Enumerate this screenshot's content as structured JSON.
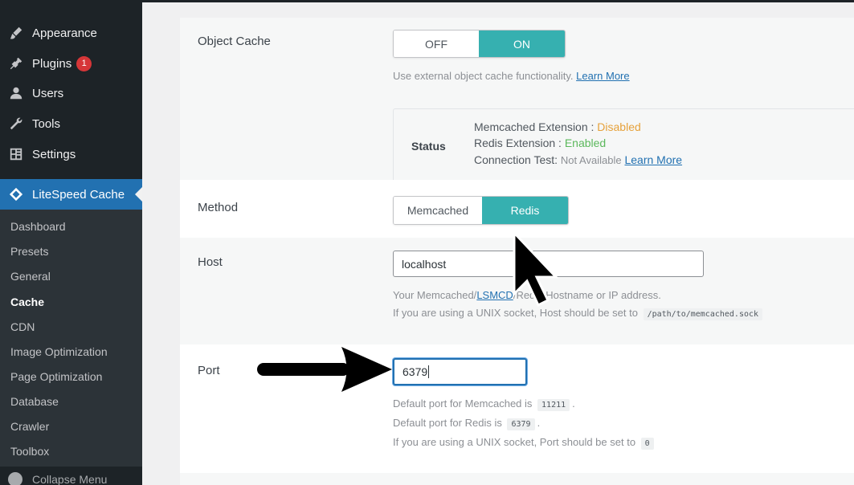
{
  "sidebar": {
    "items": [
      {
        "label": "Appearance",
        "icon": "paintbrush-icon"
      },
      {
        "label": "Plugins",
        "icon": "plugin-icon",
        "badge": "1"
      },
      {
        "label": "Users",
        "icon": "user-icon"
      },
      {
        "label": "Tools",
        "icon": "wrench-icon"
      },
      {
        "label": "Settings",
        "icon": "settings-icon"
      }
    ],
    "active_plugin": {
      "label": "LiteSpeed Cache",
      "icon": "litespeed-diamond-icon"
    },
    "submenu": [
      "Dashboard",
      "Presets",
      "General",
      "Cache",
      "CDN",
      "Image Optimization",
      "Page Optimization",
      "Database",
      "Crawler",
      "Toolbox"
    ],
    "active_submenu": "Cache",
    "collapse_label": "Collapse Menu"
  },
  "object_cache": {
    "label": "Object Cache",
    "off_label": "OFF",
    "on_label": "ON",
    "selected": "ON",
    "desc": "Use external object cache functionality.",
    "learn_more": "Learn More",
    "status": {
      "title": "Status",
      "memcached_label": "Memcached Extension :",
      "memcached_value": "Disabled",
      "redis_label": "Redis Extension :",
      "redis_value": "Enabled",
      "conn_label": "Connection Test:",
      "conn_value": "Not Available",
      "learn_more": "Learn More"
    }
  },
  "method": {
    "label": "Method",
    "memcached_label": "Memcached",
    "redis_label": "Redis",
    "selected": "Redis"
  },
  "host": {
    "label": "Host",
    "value": "localhost",
    "desc_prefix": "Your Memcached/",
    "desc_link": "LSMCD",
    "desc_suffix": "/Redis Hostname or IP address.",
    "desc2": "If you are using a UNIX socket, Host should be set to",
    "socket_path": "/path/to/memcached.sock"
  },
  "port": {
    "label": "Port",
    "value": "6379",
    "desc1": "Default port for Memcached is",
    "memcached_port": "11211",
    "desc2": "Default port for Redis is",
    "redis_port": "6379",
    "desc3": "If you are using a UNIX socket, Port should be set to",
    "socket_port": "0"
  },
  "colors": {
    "sidebar_bg": "#1d2327",
    "active_menu": "#2271b1",
    "toggle_on": "#36b0b0",
    "disabled": "#e6a23c",
    "enabled": "#5cb85c",
    "badge": "#d63638"
  }
}
